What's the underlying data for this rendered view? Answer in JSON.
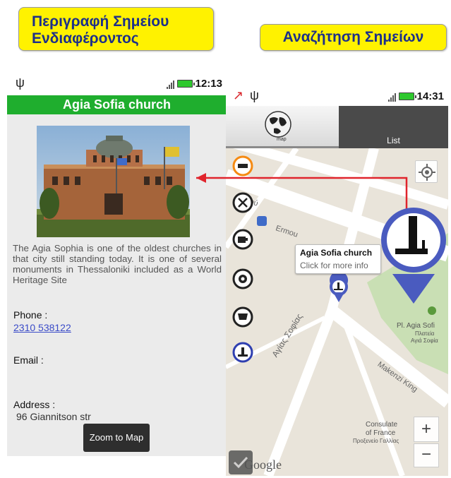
{
  "callouts": {
    "left_line1": "Περιγραφή Σημείου",
    "left_line2": "Ενδιαφέροντος",
    "right": "Αναζήτηση  Σημείων"
  },
  "left_phone": {
    "status": {
      "time": "12:13",
      "usb_icon": "usb-icon"
    },
    "title": "Agia Sofia church",
    "description": "The Agia Sophia is one of the oldest churches in that city still standing today. It is one of several monuments in Thessaloniki included as a World Heritage Site",
    "phone_label": "Phone :",
    "phone_value": "2310 538122",
    "email_label": "Email :",
    "address_label": "Address :",
    "address_value": "96 Giannitson str",
    "zoom_button": "Zoom to Map"
  },
  "right_phone": {
    "status": {
      "time": "14:31"
    },
    "tabs": {
      "map_label": "map",
      "list_label": "List"
    },
    "popup": {
      "title": "Agia Sofia church",
      "subtitle": "Click for more info"
    },
    "map_labels": {
      "street_1": "Ερμού",
      "street_1b": "Ermou",
      "street_2": "Αγίας Σοφίας",
      "street_3": "Makenzi King",
      "place_1a": "Pl. Agia Sofi",
      "place_1b": "Πλατεία",
      "place_1c": "Αγιά Σοφία",
      "consulate_1": "Consulate",
      "consulate_2": "of France",
      "consulate_3": "Προξενείο Γαλλίας",
      "google": "Google"
    },
    "zoom": {
      "plus": "+",
      "minus": "−"
    },
    "categories": [
      "hotel-icon",
      "restaurant-icon",
      "cafe-icon",
      "settings-icon",
      "shopping-icon",
      "monument-icon"
    ]
  },
  "colors": {
    "callout_bg": "#fff200",
    "callout_text": "#1c2f8a",
    "title_bar": "#1fae2e",
    "arrow": "#e0242c",
    "pin": "#4a5bbf"
  }
}
